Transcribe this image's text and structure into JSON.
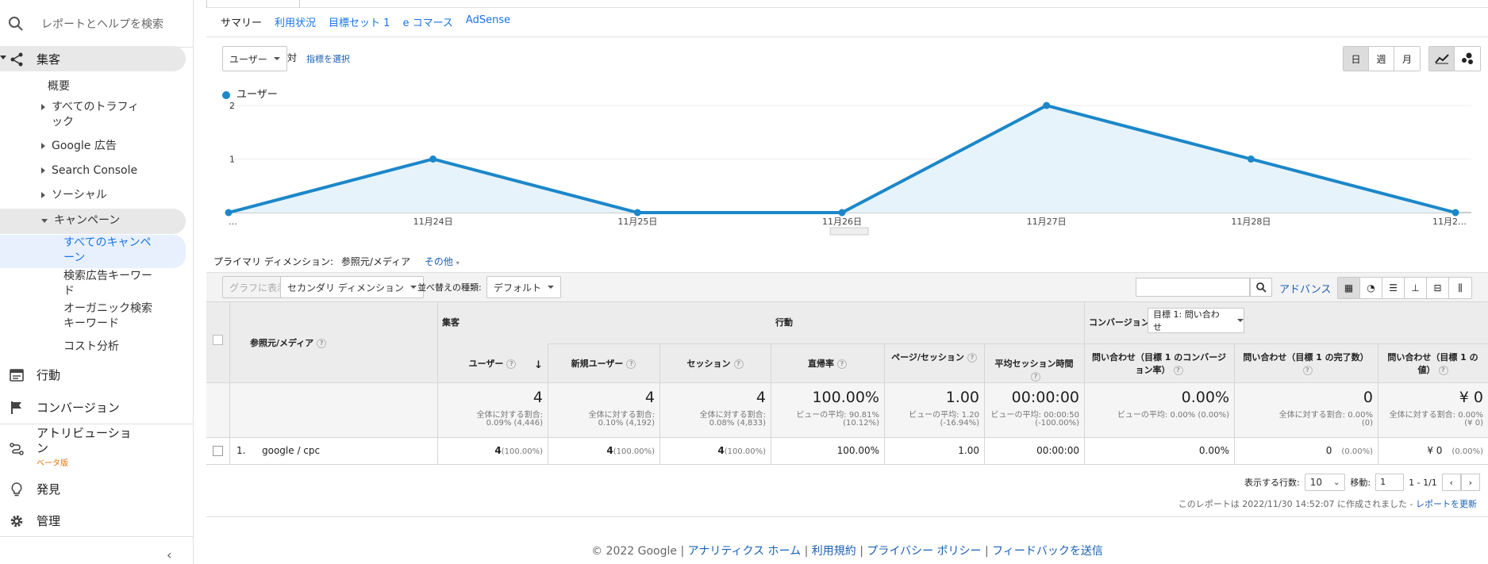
{
  "sidebar": {
    "search_label": "レポートとヘルプを検索",
    "acquisition": "集客",
    "overview": "概要",
    "all_traffic": [
      "すべてのトラフィ",
      "ック"
    ],
    "google_ads": "Google 広告",
    "search_console": "Search Console",
    "social": "ソーシャル",
    "campaigns": "キャンペーン",
    "all_campaigns": [
      "すべてのキャンペ",
      "ーン"
    ],
    "paid_keywords": [
      "検索広告キーワー",
      "ド"
    ],
    "organic_keywords": [
      "オーガニック検索",
      "キーワード"
    ],
    "cost_analysis": "コスト分析",
    "behavior": "行動",
    "conversions": "コンバージョン",
    "attribution": [
      "アトリビューショ",
      "ン"
    ],
    "beta": "ベータ版",
    "discover": "発見",
    "admin": "管理"
  },
  "tabs": [
    "サマリー",
    "利用状況",
    "目標セット 1",
    "e コマース",
    "AdSense"
  ],
  "chart_controls": {
    "metric": "ユーザー",
    "vs": "対",
    "select_metric": "指標を選択",
    "periods": [
      "日",
      "週",
      "月"
    ]
  },
  "chart_data": {
    "type": "area",
    "legend": "ユーザー",
    "x": [
      "…",
      "11月24日",
      "11月25日",
      "11月26日",
      "11月27日",
      "11月28日",
      "11月2…"
    ],
    "values": [
      0,
      1,
      0,
      0,
      2,
      1,
      0
    ],
    "yticks": [
      "2",
      "1"
    ],
    "ylim": [
      0,
      2
    ],
    "color": "#1c87c9"
  },
  "dimension_bar": {
    "label": "プライマリ ディメンション:",
    "current": "参照元/メディア",
    "other": "その他"
  },
  "toolbar": {
    "plot": "グラフに表示",
    "secondary": "セカンダリ ディメンション",
    "sort_label": "並べ替えの種類:",
    "sort": "デフォルト",
    "advanced": "アドバンス"
  },
  "table": {
    "dim_header": "参照元/メディア",
    "group_acq": "集客",
    "group_beh": "行動",
    "group_conv": "コンバージョン",
    "goal_select": "目標 1: 問い合わせ",
    "cols": [
      "ユーザー",
      "新規ユーザー",
      "セッション",
      "直帰率",
      "ページ/セッション",
      "平均セッション時間",
      "問い合わせ（目標 1 のコンバージョン率）",
      "問い合わせ（目標 1 の完了数）",
      "問い合わせ（目標 1 の値）"
    ],
    "totals": [
      {
        "main": "4",
        "sub1": "全体に対する割合:",
        "sub2": "0.09% (4,446)"
      },
      {
        "main": "4",
        "sub1": "全体に対する割合:",
        "sub2": "0.10% (4,192)"
      },
      {
        "main": "4",
        "sub1": "全体に対する割合:",
        "sub2": "0.08% (4,833)"
      },
      {
        "main": "100.00%",
        "sub1": "ビューの平均: 90.81%",
        "sub2": "(10.12%)"
      },
      {
        "main": "1.00",
        "sub1": "ビューの平均: 1.20",
        "sub2": "(-16.94%)"
      },
      {
        "main": "00:00:00",
        "sub1": "ビューの平均: 00:00:50",
        "sub2": "(-100.00%)"
      },
      {
        "main": "0.00%",
        "sub1": "ビューの平均: 0.00% (0.00%)",
        "sub2": ""
      },
      {
        "main": "0",
        "sub1": "全体に対する割合: 0.00%",
        "sub2": "(0)"
      },
      {
        "main": "¥ 0",
        "sub1": "全体に対する割合: 0.00%",
        "sub2": "(¥ 0)"
      }
    ],
    "row": {
      "index": "1.",
      "name": "google / cpc",
      "vals": [
        {
          "v": "4",
          "p": "(100.00%)"
        },
        {
          "v": "4",
          "p": "(100.00%)"
        },
        {
          "v": "4",
          "p": "(100.00%)"
        },
        {
          "v": "100.00%",
          "p": ""
        },
        {
          "v": "1.00",
          "p": ""
        },
        {
          "v": "00:00:00",
          "p": ""
        },
        {
          "v": "0.00%",
          "p": ""
        },
        {
          "v": "0",
          "p": "(0.00%)"
        },
        {
          "v": "¥ 0",
          "p": "(0.00%)"
        }
      ]
    }
  },
  "pager": {
    "rows_label": "表示する行数:",
    "rows": "10",
    "goto_label": "移動:",
    "goto": "1",
    "range": "1 - 1/1"
  },
  "report_note": "このレポートは 2022/11/30 14:52:07 に作成されました -",
  "refresh": "レポートを更新",
  "footer": {
    "copyright": "© 2022 Google |",
    "links": [
      "アナリティクス ホーム",
      "利用規約",
      "プライバシー ポリシー",
      "フィードバックを送信"
    ]
  }
}
